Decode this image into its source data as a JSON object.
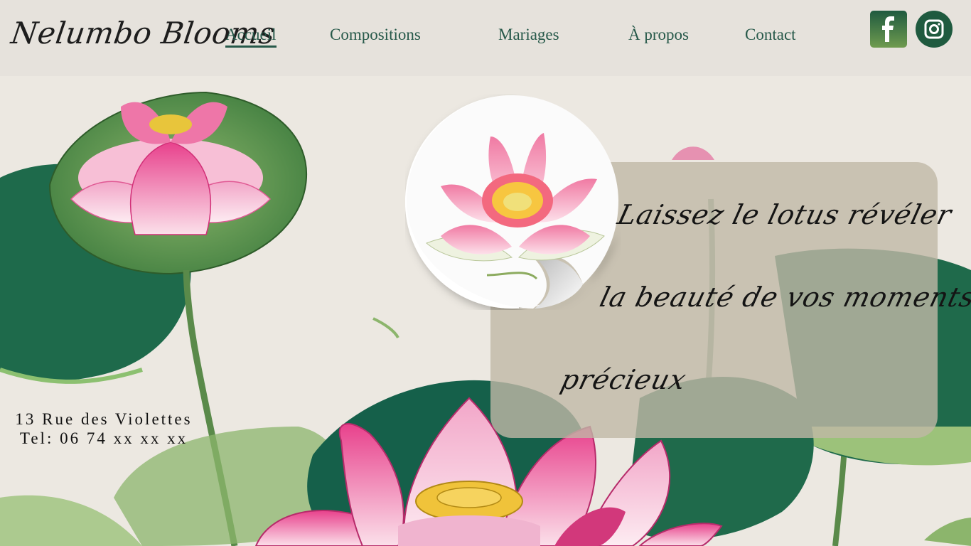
{
  "brand": {
    "name": "Nelumbo Blooms"
  },
  "nav": {
    "items": [
      {
        "label": "Accueil",
        "active": true
      },
      {
        "label": "Compositions",
        "active": false
      },
      {
        "label": "Mariages",
        "active": false
      },
      {
        "label": "À propos",
        "active": false
      },
      {
        "label": "Contact",
        "active": false
      }
    ]
  },
  "social": {
    "facebook_icon": "facebook-icon",
    "instagram_icon": "instagram-icon"
  },
  "contact": {
    "address": "13 Rue des Violettes",
    "phone": "Tel: 06 74 xx xx xx"
  },
  "hero": {
    "line1": "Laissez le lotus révéler",
    "line2": "la beauté de vos moments",
    "line3": "précieux"
  },
  "colors": {
    "accent": "#27594a",
    "panel": "#c0b8a6",
    "lotus": "#f0a9c4",
    "leaf": "#1f6a4a"
  }
}
